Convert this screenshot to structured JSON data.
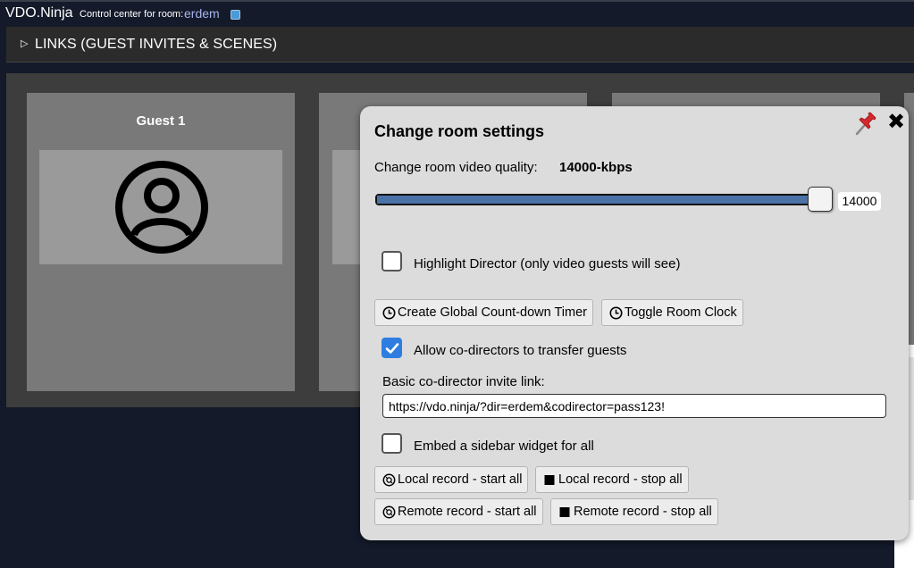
{
  "header": {
    "app_title": "VDO.Ninja",
    "room_label": "Control center for room:",
    "room_name": "erdem",
    "edit_icon": "edit-icon"
  },
  "links_bar": {
    "label": "LINKS (GUEST INVITES & SCENES)",
    "caret_icon": "caret-right-icon"
  },
  "guests": [
    {
      "title": "Guest 1",
      "icon": "user-avatar-icon"
    }
  ],
  "modal": {
    "title": "Change room settings",
    "quality_label": "Change room video quality:",
    "quality_value": "14000-kbps",
    "slider": {
      "value": 14000,
      "readout": "14000",
      "fill_fraction": 1.0,
      "color": "#4a72a6"
    },
    "highlight_director": {
      "label": "Highlight Director (only video guests will see)",
      "checked": false
    },
    "buttons_row1": [
      {
        "label": "Create Global Count-down Timer",
        "icon": "clock-icon"
      },
      {
        "label": "Toggle Room Clock",
        "icon": "clock-icon"
      }
    ],
    "allow_codirectors": {
      "label": "Allow co-directors to transfer guests",
      "checked": true
    },
    "invite_link_label": "Basic co-director invite link:",
    "invite_link_value": "https://vdo.ninja/?dir=erdem&codirector=pass123!",
    "embed_sidebar": {
      "label": "Embed a sidebar widget for all",
      "checked": false
    },
    "record_buttons": [
      {
        "label": "Local record - start all",
        "icon": "record-start-icon"
      },
      {
        "label": "Local record - stop all",
        "icon": "stop-square-icon"
      },
      {
        "label": "Remote record - start all",
        "icon": "record-start-icon"
      },
      {
        "label": "Remote record - stop all",
        "icon": "stop-square-icon"
      }
    ],
    "pin_icon": "pin-icon",
    "close_icon": "close-icon"
  },
  "colors": {
    "page_bg": "#141a2a",
    "accent_blue": "#2f7de1",
    "modal_bg": "#dcdcdc",
    "room_name": "#a6b4ea"
  }
}
